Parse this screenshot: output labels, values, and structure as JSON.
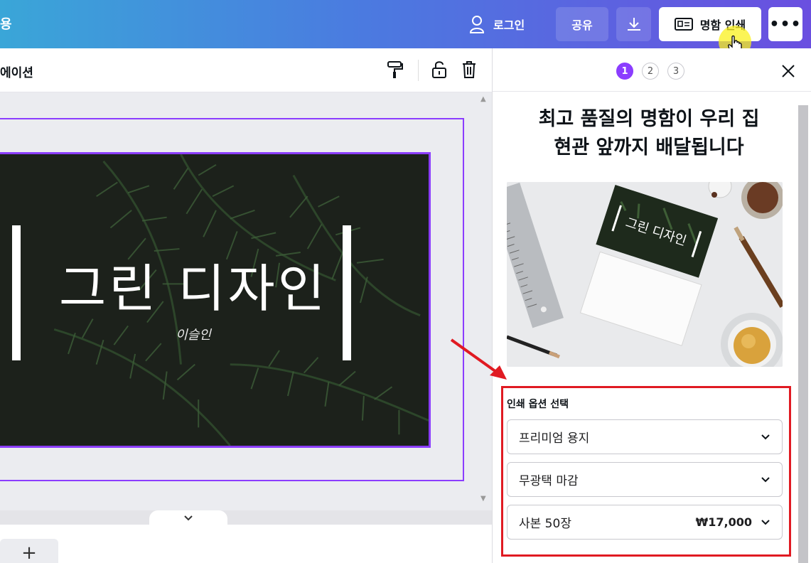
{
  "topbar": {
    "app_cut_text": "용",
    "login_label": "로그인",
    "share_label": "공유",
    "print_label": "명함 인쇄",
    "more_label": "•••"
  },
  "editor": {
    "toolbar_label_cut": "에이션"
  },
  "card": {
    "title": "그린 디자인",
    "subtitle": "이슬인"
  },
  "panel": {
    "steps": [
      "1",
      "2",
      "3"
    ],
    "active_step": "1",
    "title_line1": "최고 품질의 명함이 우리 집",
    "title_line2": "현관 앞까지 배달됩니다",
    "photo_card_title": "그린 디자인",
    "options_title": "인쇄 옵션 선택",
    "options": [
      {
        "label": "프리미엄 용지",
        "price": ""
      },
      {
        "label": "무광택 마감",
        "price": ""
      },
      {
        "label": "사본 50장",
        "price": "₩17,000"
      }
    ]
  },
  "colors": {
    "accent": "#8b3dff",
    "highlight": "#e01a22"
  }
}
